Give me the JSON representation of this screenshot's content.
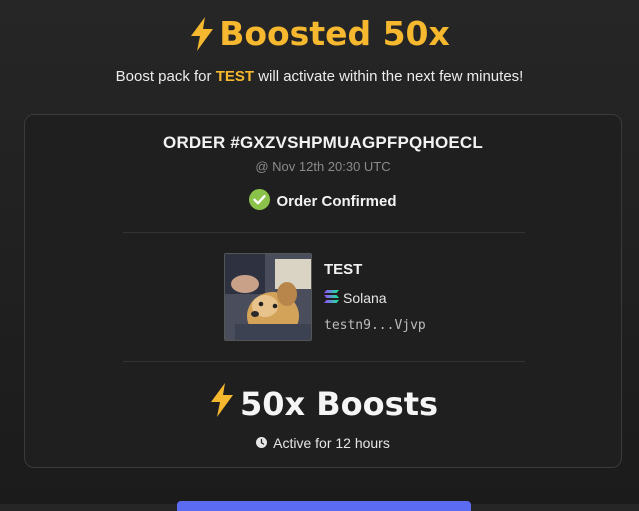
{
  "header": {
    "title": "Boosted 50x",
    "subtitle_prefix": "Boost pack for ",
    "subtitle_token": "TEST",
    "subtitle_suffix": " will activate within the next few minutes!"
  },
  "order": {
    "id": "ORDER #GXZVSHPMUAGPFPQHOECL",
    "date": "@ Nov 12th 20:30 UTC",
    "status": "Order Confirmed",
    "status_icon": "check-circle-icon"
  },
  "token": {
    "name": "TEST",
    "chain": "Solana",
    "address": "testn9...Vjvp",
    "image": "dog-photo"
  },
  "boost": {
    "label": "50x Boosts",
    "duration": "Active for 12 hours",
    "icon": "lightning-icon"
  },
  "colors": {
    "accent": "#f5b82e",
    "confirmed": "#8bc34a",
    "button": "#5b6cf2"
  }
}
